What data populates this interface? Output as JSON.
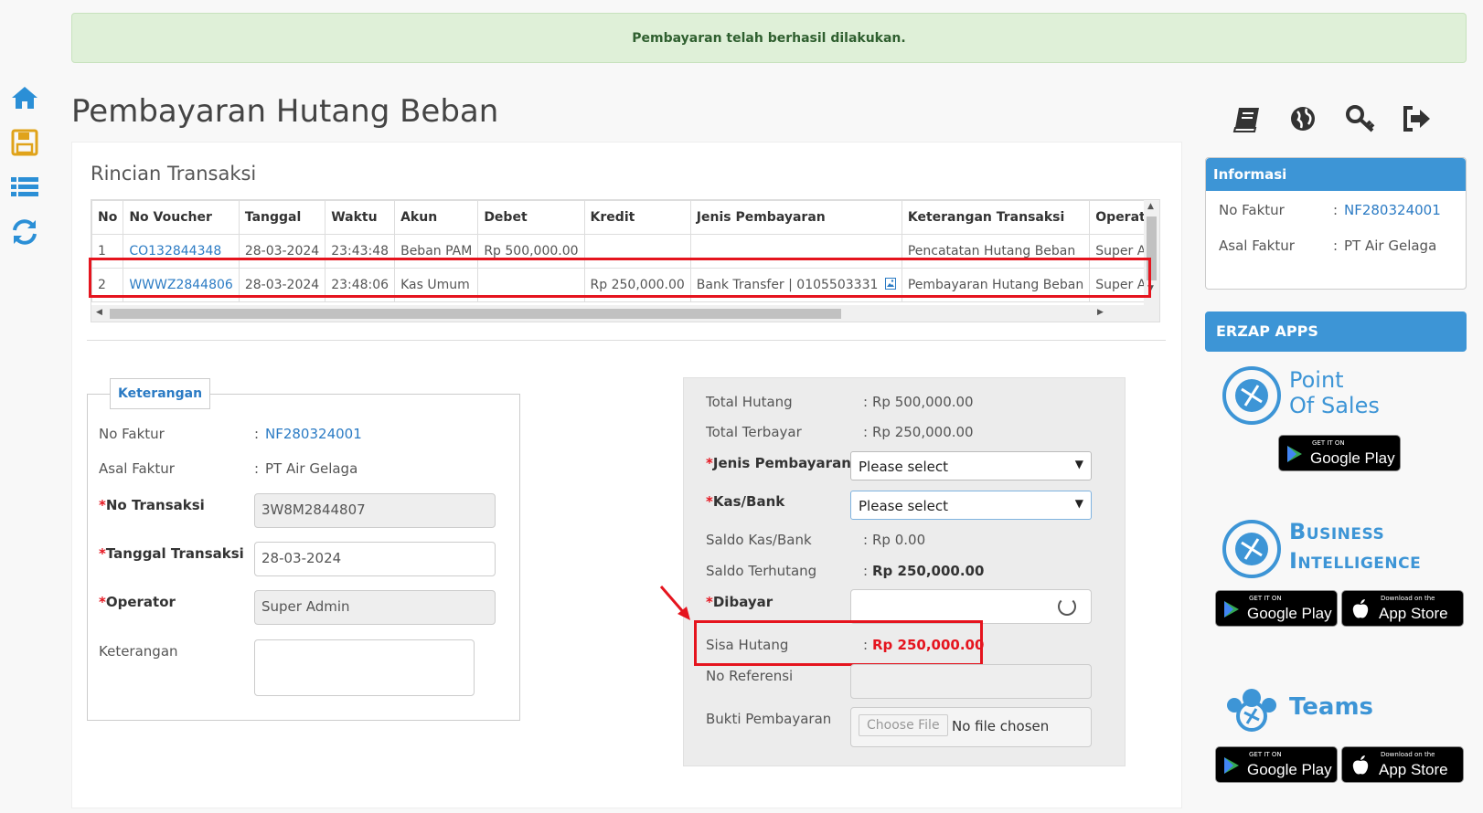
{
  "alert": {
    "message": "Pembayaran telah berhasil dilakukan."
  },
  "page": {
    "title": "Pembayaran Hutang Beban"
  },
  "nav_icons": [
    "home-icon",
    "save-icon",
    "list-icon",
    "refresh-icon"
  ],
  "top_icons": [
    "book-icon",
    "globe-icon",
    "key-icon",
    "logout-icon"
  ],
  "transaksi": {
    "title": "Rincian Transaksi",
    "columns": [
      "No",
      "No Voucher",
      "Tanggal",
      "Waktu",
      "Akun",
      "Debet",
      "Kredit",
      "Jenis Pembayaran",
      "Keterangan Transaksi",
      "Operator"
    ],
    "rows": [
      [
        "1",
        "CO132844348",
        "28-03-2024",
        "23:43:48",
        "Beban PAM",
        "Rp 500,000.00",
        "",
        "",
        "Pencatatan Hutang Beban",
        "Super Admin"
      ],
      [
        "2",
        "WWWZ2844806",
        "28-03-2024",
        "23:48:06",
        "Kas Umum",
        "",
        "Rp 250,000.00",
        "Bank Transfer | 0105503331",
        "Pembayaran Hutang Beban",
        "Super Admin"
      ]
    ]
  },
  "keterangan": {
    "legend": "Keterangan",
    "no_faktur_label": "No Faktur",
    "no_faktur": "NF280324001",
    "asal_faktur_label": "Asal Faktur",
    "asal_faktur": "PT Air Gelaga",
    "no_transaksi_label": "No Transaksi",
    "no_transaksi": "3W8M2844807",
    "tanggal_label": "Tanggal Transaksi",
    "tanggal": "28-03-2024",
    "operator_label": "Operator",
    "operator": "Super Admin",
    "keterangan_label": "Keterangan"
  },
  "pembayaran": {
    "total_hutang_label": "Total Hutang",
    "total_hutang": "Rp 500,000.00",
    "total_terbayar_label": "Total Terbayar",
    "total_terbayar": "Rp 250,000.00",
    "jenis_label": "Jenis Pembayaran",
    "jenis_value": "Please select",
    "kas_label": "Kas/Bank",
    "kas_value": "Please select",
    "saldo_kas_label": "Saldo Kas/Bank",
    "saldo_kas": "Rp 0.00",
    "saldo_terhutang_label": "Saldo Terhutang",
    "saldo_terhutang": "Rp 250,000.00",
    "dibayar_label": "Dibayar",
    "sisa_label": "Sisa Hutang",
    "sisa": "Rp 250,000.00",
    "no_referensi_label": "No Referensi",
    "bukti_label": "Bukti Pembayaran",
    "file_button": "Choose File",
    "file_status": "No file chosen"
  },
  "informasi": {
    "title": "Informasi",
    "no_faktur_label": "No Faktur",
    "no_faktur": "NF280324001",
    "asal_faktur_label": "Asal Faktur",
    "asal_faktur": "PT Air Gelaga"
  },
  "apps": {
    "title": "ERZAP APPS",
    "pos": {
      "line1": "Point",
      "line2": "Of Sales"
    },
    "bi": {
      "line1": "Business",
      "line2": "Intelligence"
    },
    "teams": {
      "name": "Teams"
    },
    "google_small": "GET IT ON",
    "google_big": "Google Play",
    "apple_small": "Download on the",
    "apple_big": "App Store"
  },
  "colors": {
    "accent": "#3d95d6",
    "highlight": "#e5141e",
    "success_bg": "#dff0d8"
  }
}
